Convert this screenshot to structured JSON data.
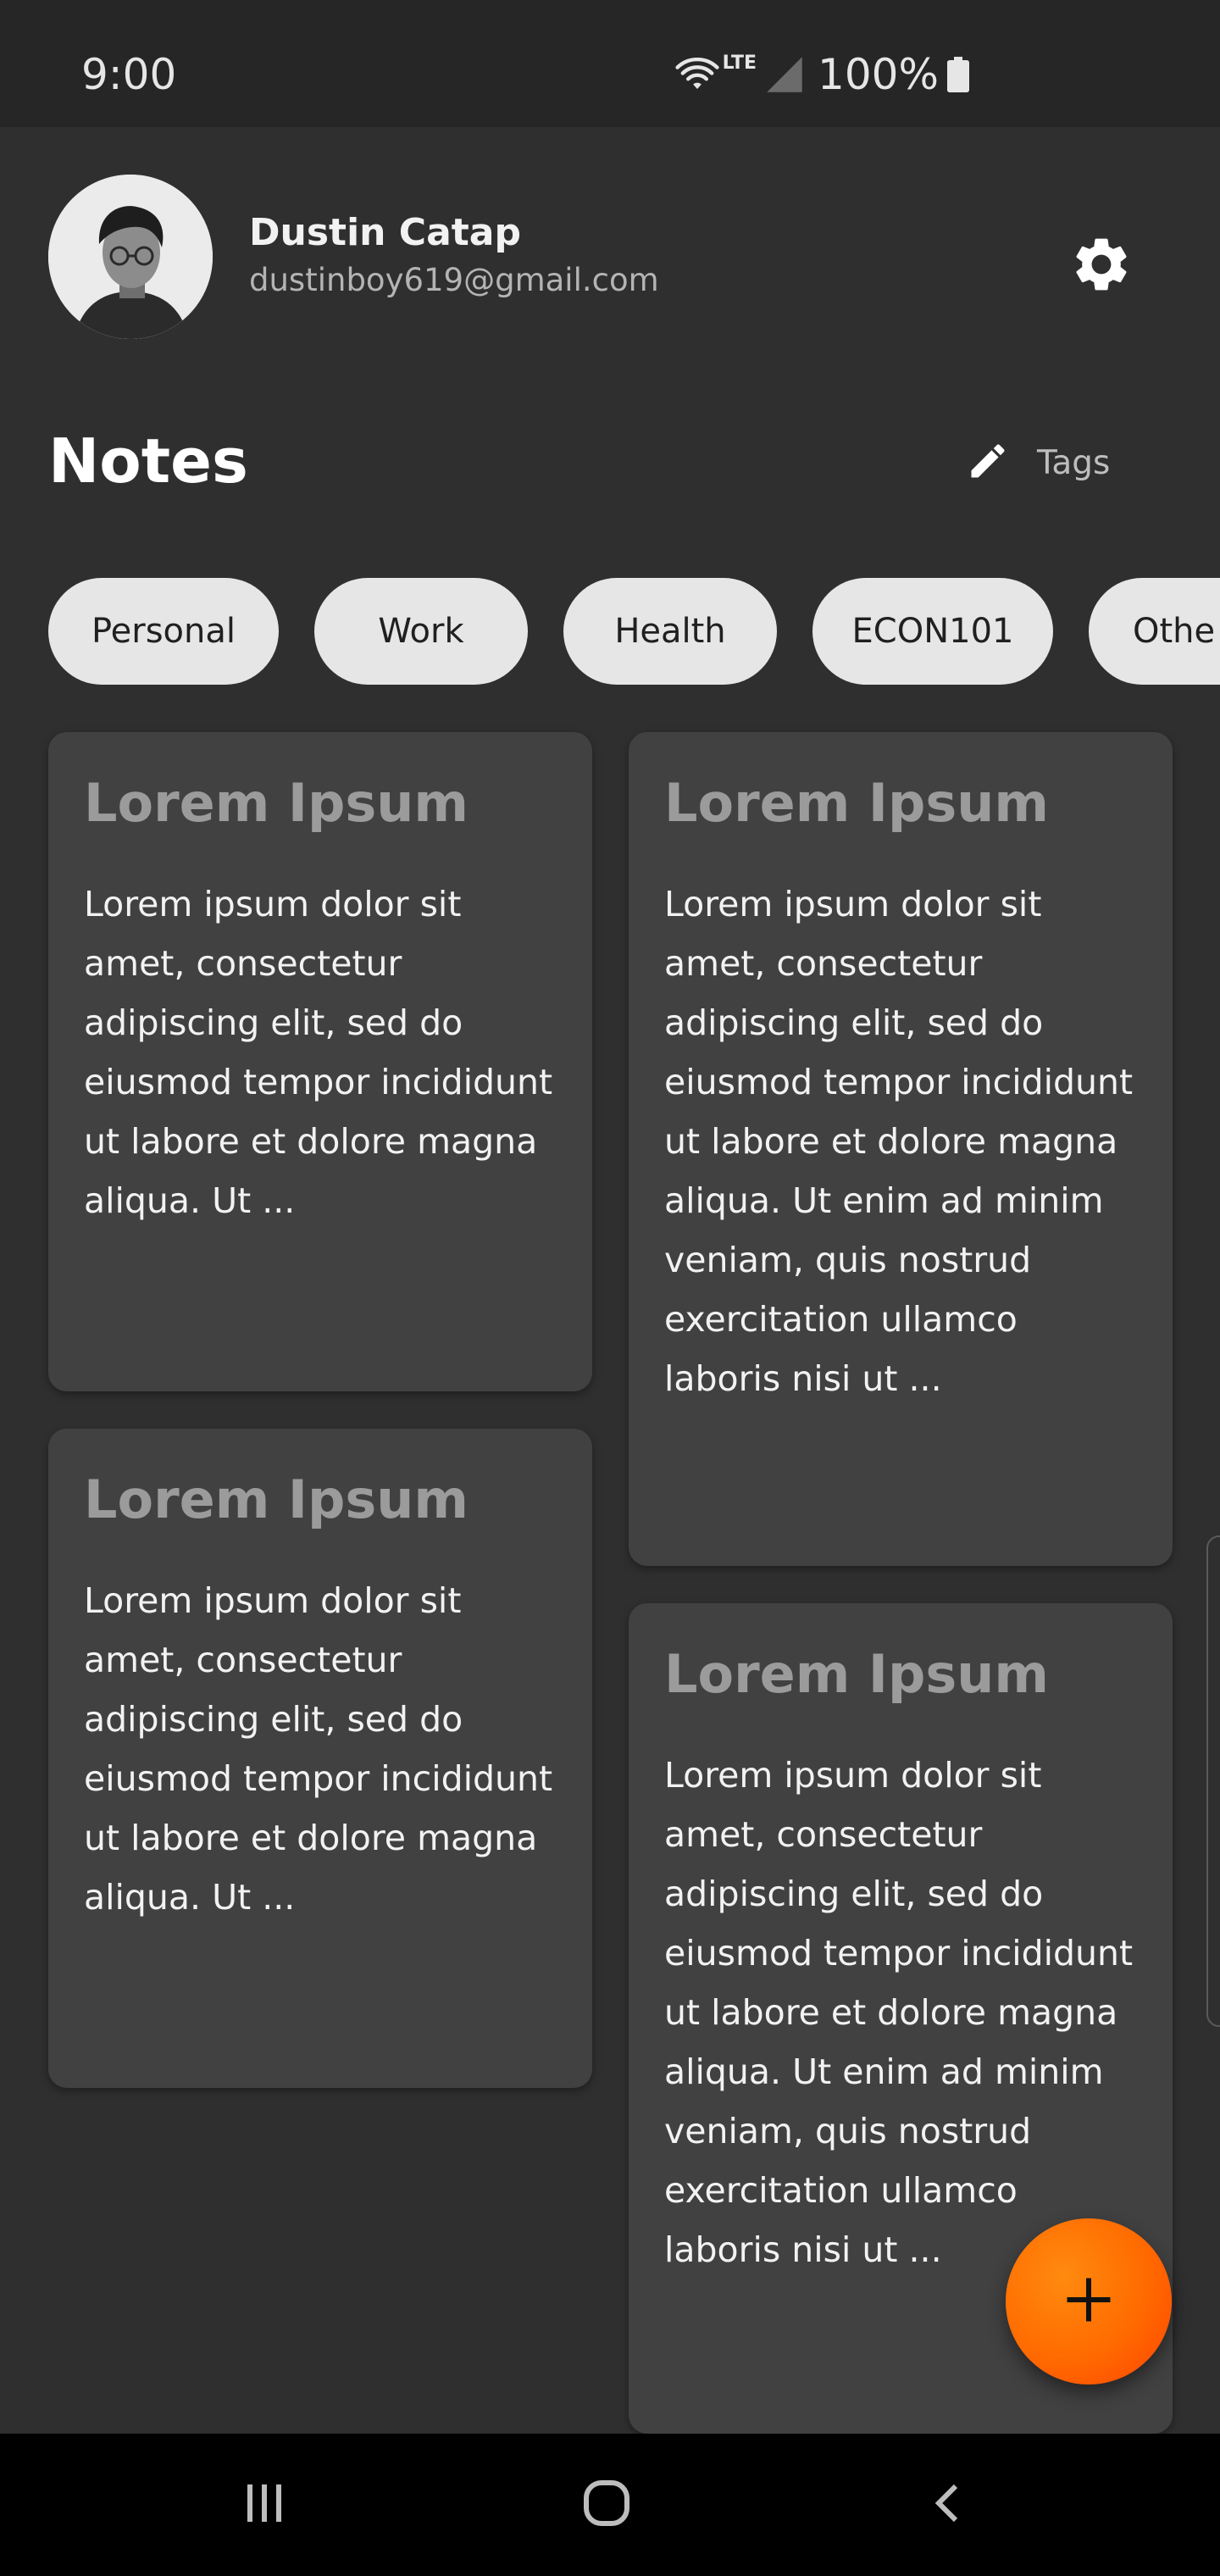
{
  "status_bar": {
    "time": "9:00",
    "network": "LTE",
    "battery": "100%"
  },
  "profile": {
    "name": "Dustin Catap",
    "email": "dustinboy619@gmail.com"
  },
  "header": {
    "title": "Notes",
    "tags_label": "Tags"
  },
  "tags": [
    "Personal",
    "Work",
    "Health",
    "ECON101",
    "Othe"
  ],
  "notes": {
    "left": [
      {
        "title": "Lorem Ipsum",
        "body": "Lorem ipsum dolor sit amet, consectetur adipiscing elit, sed do eiusmod tempor incididunt ut labore et dolore magna aliqua. Ut ..."
      },
      {
        "title": "Lorem Ipsum",
        "body": "Lorem ipsum dolor sit amet, consectetur adipiscing elit, sed do eiusmod tempor incididunt ut labore et dolore magna aliqua. Ut ..."
      }
    ],
    "right": [
      {
        "title": "Lorem Ipsum",
        "body": "Lorem ipsum dolor sit amet, consectetur adipiscing elit, sed do eiusmod tempor incididunt ut labore et dolore magna aliqua. Ut enim ad minim veniam, quis nostrud exercitation ullamco laboris nisi ut ..."
      },
      {
        "title": "Lorem Ipsum",
        "body": "Lorem ipsum dolor sit amet, consectetur adipiscing elit, sed do eiusmod tempor incididunt ut labore et dolore magna aliqua. Ut enim ad minim veniam, quis nostrud exercitation ullamco laboris nisi ut ..."
      }
    ]
  },
  "icons": {
    "settings": "gear-icon",
    "tags": "pencil-icon",
    "fab": "plus-icon",
    "nav_recents": "recents-icon",
    "nav_home": "home-icon",
    "nav_back": "back-icon"
  },
  "colors": {
    "background": "#2f2f30",
    "card": "#414142",
    "chip": "#e6e6e6",
    "accent": "#ff6a00"
  }
}
